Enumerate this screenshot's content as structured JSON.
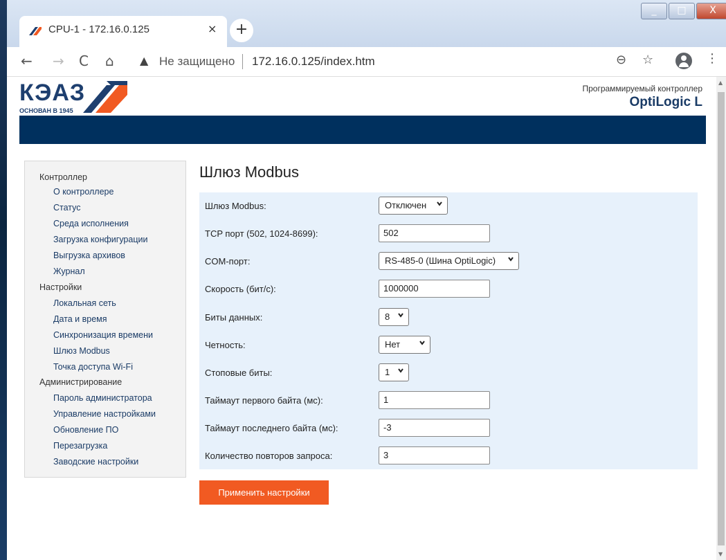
{
  "browser": {
    "tab_title": "CPU-1 - 172.16.0.125",
    "tab_close": "×",
    "new_tab": "+",
    "insecure_label": "Не защищено",
    "url": "172.16.0.125/index.htm",
    "window_buttons": {
      "minimize": "_",
      "maximize": "□",
      "close": "X"
    }
  },
  "header": {
    "logo_text": "КЭАЗ",
    "logo_sub": "ОСНОВАН В 1945",
    "product_caption": "Программируемый контроллер",
    "product_name": "OptiLogic L",
    "banner_color": "#00305e"
  },
  "sidebar": {
    "groups": [
      {
        "label": "Контроллер",
        "items": [
          "О контроллере",
          "Статус",
          "Среда исполнения",
          "Загрузка конфигурации",
          "Выгрузка архивов",
          "Журнал"
        ]
      },
      {
        "label": "Настройки",
        "items": [
          "Локальная сеть",
          "Дата и время",
          "Синхронизация времени",
          "Шлюз Modbus",
          "Точка доступа Wi-Fi"
        ]
      },
      {
        "label": "Администрирование",
        "items": [
          "Пароль администратора",
          "Управление настройками",
          "Обновление ПО",
          "Перезагрузка",
          "Заводские настройки"
        ]
      }
    ]
  },
  "main": {
    "title": "Шлюз Modbus",
    "fields": {
      "gateway": {
        "label": "Шлюз Modbus:",
        "value": "Отключен"
      },
      "tcp_port": {
        "label": "TCP порт (502, 1024-8699):",
        "value": "502"
      },
      "com_port": {
        "label": "COM-порт:",
        "value": "RS-485-0 (Шина OptiLogic)"
      },
      "speed": {
        "label": "Скорость (бит/с):",
        "value": "1000000"
      },
      "data_bits": {
        "label": "Биты данных:",
        "value": "8"
      },
      "parity": {
        "label": "Четность:",
        "value": "Нет"
      },
      "stop_bits": {
        "label": "Стоповые биты:",
        "value": "1"
      },
      "first_byte_timeout": {
        "label": "Таймаут первого байта (мс):",
        "value": "1"
      },
      "last_byte_timeout": {
        "label": "Таймаут последнего байта (мс):",
        "value": "-3"
      },
      "retries": {
        "label": "Количество повторов запроса:",
        "value": "3"
      }
    },
    "apply_button": "Применить настройки",
    "accent_color": "#f15a22"
  }
}
